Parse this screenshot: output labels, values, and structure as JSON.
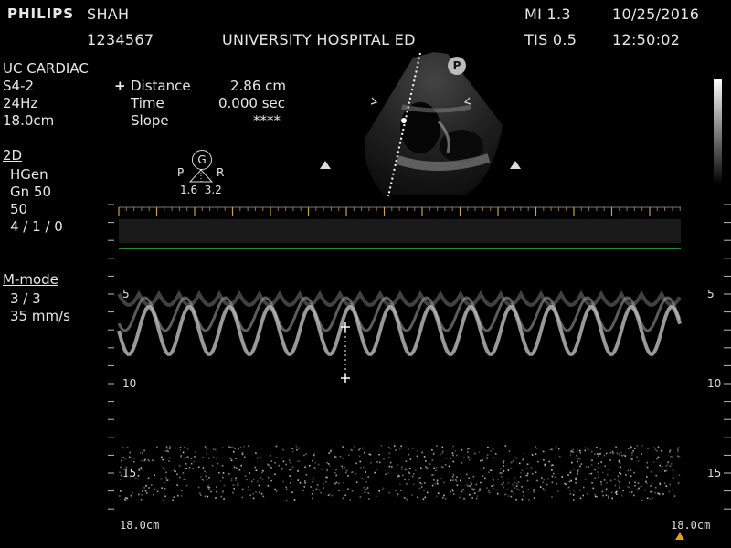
{
  "header": {
    "brand": "PHILIPS",
    "patient_name": "SHAH",
    "patient_id": "1234567",
    "institution": "UNIVERSITY HOSPITAL ED",
    "mi": "MI 1.3",
    "tis": "TIS 0.5",
    "date": "10/25/2016",
    "time": "12:50:02"
  },
  "left_panel": {
    "preset": "UC CARDIAC",
    "probe": "S4-2",
    "frame_rate": "24Hz",
    "depth": "18.0cm",
    "mode_2d": {
      "title": "2D",
      "lines": [
        "HGen",
        "Gn 50",
        "50",
        "4 / 1 / 0"
      ]
    },
    "mode_m": {
      "title": "M-mode",
      "lines": [
        "3 / 3",
        "35 mm/s"
      ]
    }
  },
  "measurement": {
    "marker": "+",
    "rows": [
      {
        "label": "Distance",
        "value": "2.86 cm"
      },
      {
        "label": "Time",
        "value": "0.000 sec"
      },
      {
        "label": "Slope",
        "value": "****"
      }
    ]
  },
  "orientation": {
    "badge": "G",
    "left": "P",
    "right": "R",
    "values": "1.6  3.2",
    "p_badge": "P"
  },
  "mmode": {
    "depth_ticks": [
      {
        "label": "5",
        "depth": 5
      },
      {
        "label": "10",
        "depth": 10
      },
      {
        "label": "15",
        "depth": 15
      }
    ],
    "bottom_left": "18.0cm",
    "bottom_right": "18.0cm"
  },
  "colors": {
    "green_line": "#2fb84a",
    "text": "#e8e8e8"
  }
}
